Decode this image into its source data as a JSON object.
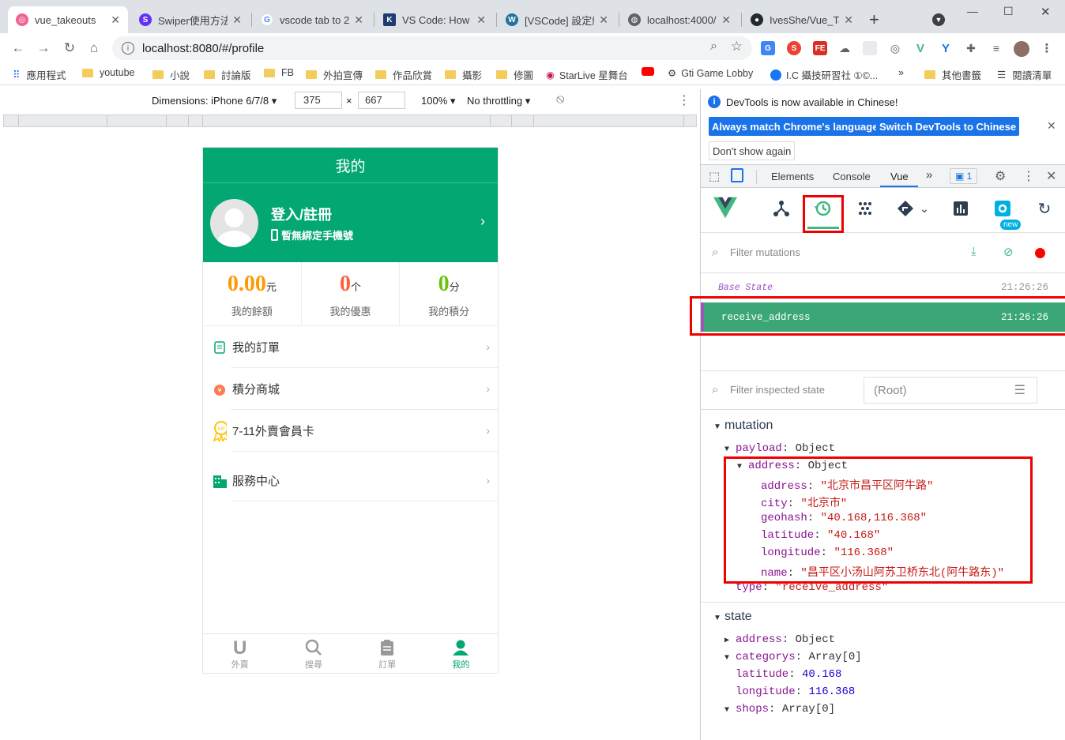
{
  "browser": {
    "tabs": [
      {
        "title": "vue_takeouts",
        "icon": "vue-takeouts-favicon-icon",
        "active": true
      },
      {
        "title": "Swiper使用方法",
        "icon": "swiper-favicon-icon"
      },
      {
        "title": "vscode tab to 2",
        "icon": "google-favicon-icon"
      },
      {
        "title": "VS Code: How T",
        "icon": "k-favicon-icon"
      },
      {
        "title": "[VSCode] 設定編",
        "icon": "wordpress-favicon-icon"
      },
      {
        "title": "localhost:4000/",
        "icon": "globe-favicon-icon"
      },
      {
        "title": "IvesShe/Vue_Ta",
        "icon": "github-favicon-icon"
      }
    ],
    "new_tab": "+",
    "url": "localhost:8080/#/profile",
    "bookmarks": [
      "應用程式",
      "youtube",
      "小說",
      "討論版",
      "FB",
      "外拍宣傳",
      "作品欣賞",
      "攝影",
      "修圖",
      "StarLive 星舞台",
      "Gti Game Lobby",
      "I.C 攝技研習社 ①©...",
      "»",
      "其他書籤",
      "閱讀清單"
    ],
    "window_controls": [
      "—",
      "☐",
      "✕"
    ]
  },
  "device_toolbar": {
    "dimensions_label": "Dimensions: iPhone 6/7/8",
    "width": "375",
    "x": "×",
    "height": "667",
    "zoom": "100%",
    "throttling": "No throttling"
  },
  "phone": {
    "header": "我的",
    "login": "登入/註冊",
    "phone_status": "暫無綁定手機號",
    "stats": [
      {
        "value": "0.00",
        "unit": "元",
        "label": "我的餘額",
        "color": "#f90"
      },
      {
        "value": "0",
        "unit": "个",
        "label": "我的優惠",
        "color": "#ff5f3e"
      },
      {
        "value": "0",
        "unit": "分",
        "label": "我的積分",
        "color": "#6ac20b"
      }
    ],
    "menu": [
      {
        "label": "我的訂單",
        "icon": "order-icon"
      },
      {
        "label": "積分商城",
        "icon": "points-mall-icon"
      },
      {
        "label": "7-11外賣會員卡",
        "icon": "vip-card-icon"
      },
      {
        "label": "服務中心",
        "icon": "service-center-icon"
      }
    ],
    "nav": [
      {
        "label": "外賣",
        "icon": "U"
      },
      {
        "label": "搜尋",
        "icon": "search-icon"
      },
      {
        "label": "訂單",
        "icon": "clipboard-icon"
      },
      {
        "label": "我的",
        "icon": "user-icon",
        "active": true
      }
    ]
  },
  "devtools": {
    "banner_text": "DevTools is now available in Chinese!",
    "btn_match": "Always match Chrome's language",
    "btn_switch": "Switch DevTools to Chinese",
    "btn_dont": "Don't show again",
    "tabs": [
      "Elements",
      "Console",
      "Vue",
      "»"
    ],
    "issues_count": "1",
    "new_badge": "new",
    "filter_mutations": "Filter mutations",
    "mutations": [
      {
        "name": "Base State",
        "time": "21:26:26"
      },
      {
        "name": "receive_address",
        "time": "21:26:26",
        "selected": true
      }
    ],
    "filter_state": "Filter inspected state",
    "root": "(Root)",
    "mutation_section": "mutation",
    "state_section": "state",
    "payload_key": "payload",
    "payload_type": "Object",
    "address_key": "address",
    "address_type": "Object",
    "address_fields": [
      {
        "key": "address",
        "value": "\"北京市昌平区阿牛路\""
      },
      {
        "key": "city",
        "value": "\"北京市\""
      },
      {
        "key": "geohash",
        "value": "\"40.168,116.368\""
      },
      {
        "key": "latitude",
        "value": "\"40.168\""
      },
      {
        "key": "longitude",
        "value": "\"116.368\""
      },
      {
        "key": "name",
        "value": "\"昌平区小汤山阿苏卫桥东北(阿牛路东)\""
      }
    ],
    "type_key": "type",
    "type_value": "\"receive_address\"",
    "state": [
      {
        "key": "address",
        "value": "Object",
        "collapsed": true
      },
      {
        "key": "categorys",
        "value": "Array[0]"
      },
      {
        "key": "latitude",
        "value": "40.168",
        "num": true
      },
      {
        "key": "longitude",
        "value": "116.368",
        "num": true
      },
      {
        "key": "shops",
        "value": "Array[0]"
      }
    ]
  },
  "colors": {
    "accent": "#02a774",
    "vue_green": "#41b883",
    "highlight": "#e00000"
  }
}
